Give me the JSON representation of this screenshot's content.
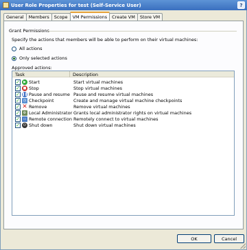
{
  "window": {
    "title": "User Role Properties for test (Self-Service User)",
    "help_label": "?"
  },
  "tabs": [
    {
      "label": "General",
      "active": false
    },
    {
      "label": "Members",
      "active": false
    },
    {
      "label": "Scope",
      "active": false
    },
    {
      "label": "VM Permissions",
      "active": true
    },
    {
      "label": "Create VM",
      "active": false
    },
    {
      "label": "Store VM",
      "active": false
    }
  ],
  "grant": {
    "group_title": "Grant Permissions",
    "description": "Specify the actions that members will be able to perform on their virtual machines:",
    "options": [
      {
        "label": "All actions",
        "selected": false
      },
      {
        "label": "Only selected actions",
        "selected": true
      }
    ],
    "approved_label": "Approved actions:"
  },
  "table": {
    "columns": [
      "Task",
      "Description"
    ],
    "rows": [
      {
        "task": "Start",
        "description": "Start virtual machines",
        "checked": true,
        "icon": "start-icon",
        "color": "#2fa83a"
      },
      {
        "task": "Stop",
        "description": "Stop virtual machines",
        "checked": true,
        "icon": "stop-icon",
        "color": "#c9302c"
      },
      {
        "task": "Pause and resume",
        "description": "Pause and resume virtual machines",
        "checked": true,
        "icon": "pause-icon",
        "color": "#3f6fc4"
      },
      {
        "task": "Checkpoint",
        "description": "Create and manage virtual machine checkpoints",
        "checked": true,
        "icon": "checkpoint-icon",
        "color": "#5a8fd1"
      },
      {
        "task": "Remove",
        "description": "Remove virtual machines",
        "checked": true,
        "icon": "remove-icon",
        "color": "#d42424"
      },
      {
        "task": "Local Administrator",
        "description": "Grants local administrator rights on virtual machines",
        "checked": true,
        "icon": "local-admin-icon",
        "color": "#6f8a5a"
      },
      {
        "task": "Remote connection",
        "description": "Remotely connect to virtual machines",
        "checked": true,
        "icon": "remote-connection-icon",
        "color": "#4a7cc4"
      },
      {
        "task": "Shut down",
        "description": "Shut down virtual machines",
        "checked": true,
        "icon": "shutdown-icon",
        "color": "#333333"
      }
    ]
  },
  "buttons": {
    "ok": "OK",
    "cancel": "Cancel"
  }
}
